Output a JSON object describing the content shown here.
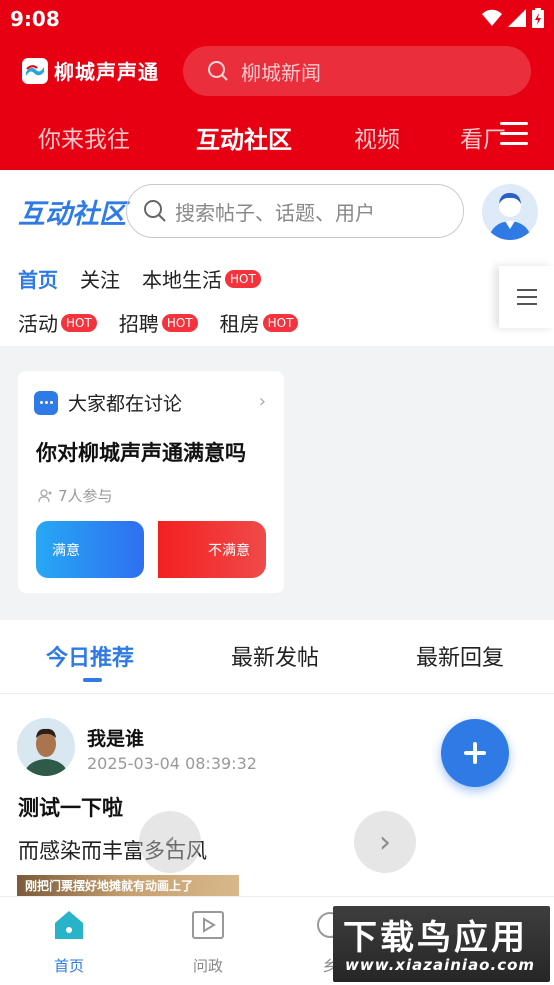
{
  "status": {
    "time": "9:08"
  },
  "app": {
    "name": "柳城声声通"
  },
  "top_search": {
    "placeholder": "柳城新闻"
  },
  "main_tabs": [
    "你来我往",
    "互动社区",
    "视频",
    "看厂"
  ],
  "community": {
    "title": "互动社区",
    "search_placeholder": "搜索帖子、话题、用户",
    "categories_row1": [
      {
        "label": "首页"
      },
      {
        "label": "关注"
      },
      {
        "label": "本地生活",
        "badge": "HOT"
      }
    ],
    "categories_row2": [
      {
        "label": "活动",
        "badge": "HOT"
      },
      {
        "label": "招聘",
        "badge": "HOT"
      },
      {
        "label": "租房",
        "badge": "HOT"
      }
    ]
  },
  "discussion": {
    "header": "大家都在讨论",
    "question": "你对柳城声声通满意吗",
    "participants": "7人参与",
    "option_yes": "满意",
    "option_no": "不满意"
  },
  "feed_tabs": [
    "今日推荐",
    "最新发帖",
    "最新回复"
  ],
  "post": {
    "user": "我是谁",
    "time": "2025-03-04 08:39:32",
    "title": "测试一下啦",
    "body": "而感染而丰富多古风",
    "image_caption": "刚把门票摆好地摊就有动画上了"
  },
  "bottom_nav": [
    "首页",
    "问政",
    "乡"
  ],
  "watermark": {
    "title": "下载鸟应用",
    "url": "www.xiazainiao.com"
  },
  "colors": {
    "brand_red": "#e60012",
    "accent_blue": "#2f7ae5",
    "hot_red": "#f4333c"
  }
}
